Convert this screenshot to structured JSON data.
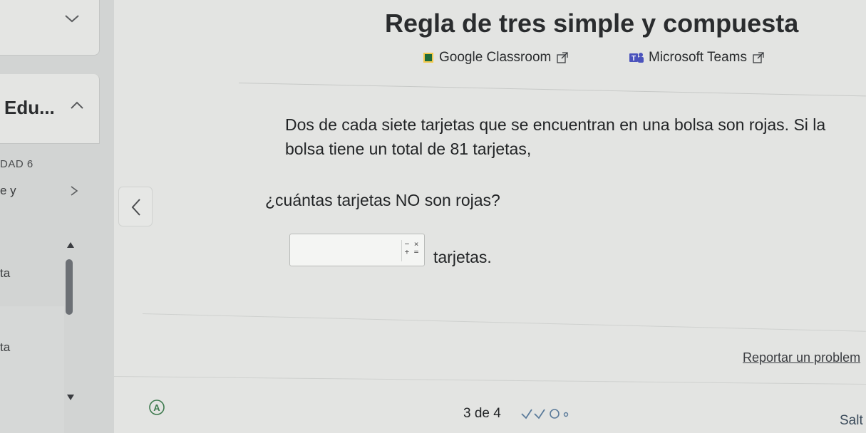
{
  "sidebar": {
    "course_title": "Edu...",
    "unit_label": "DAD 6",
    "lesson_label": "e y",
    "item_1": "ta",
    "item_2": "ta"
  },
  "header": {
    "title": "Regla de tres simple y compuesta",
    "share": [
      {
        "label": "Google Classroom",
        "icon": "google-classroom-icon"
      },
      {
        "label": "Microsoft Teams",
        "icon": "microsoft-teams-icon"
      }
    ]
  },
  "question": {
    "line_1": "Dos de cada siete tarjetas que se encuentran en una bolsa son rojas. Si la",
    "line_2": "bolsa tiene un total de 81 tarjetas,",
    "ask": "¿cuántas tarjetas NO son rojas?"
  },
  "answer": {
    "value": "",
    "unit": "tarjetas.",
    "math_icon_top": "− ×",
    "math_icon_bottom": "+ ="
  },
  "report_link": "Reportar un problem",
  "footer": {
    "progress": "3 de 4",
    "progress_marks": [
      "check",
      "check",
      "circle",
      "dot"
    ],
    "skip_label": "Salt"
  },
  "colors": {
    "background": "#e3e4e2",
    "sidebar": "#d2d4d3",
    "scroll_thumb": "#6c7075",
    "google_classroom": "#1e6b3a",
    "teams": "#4b53bc"
  }
}
